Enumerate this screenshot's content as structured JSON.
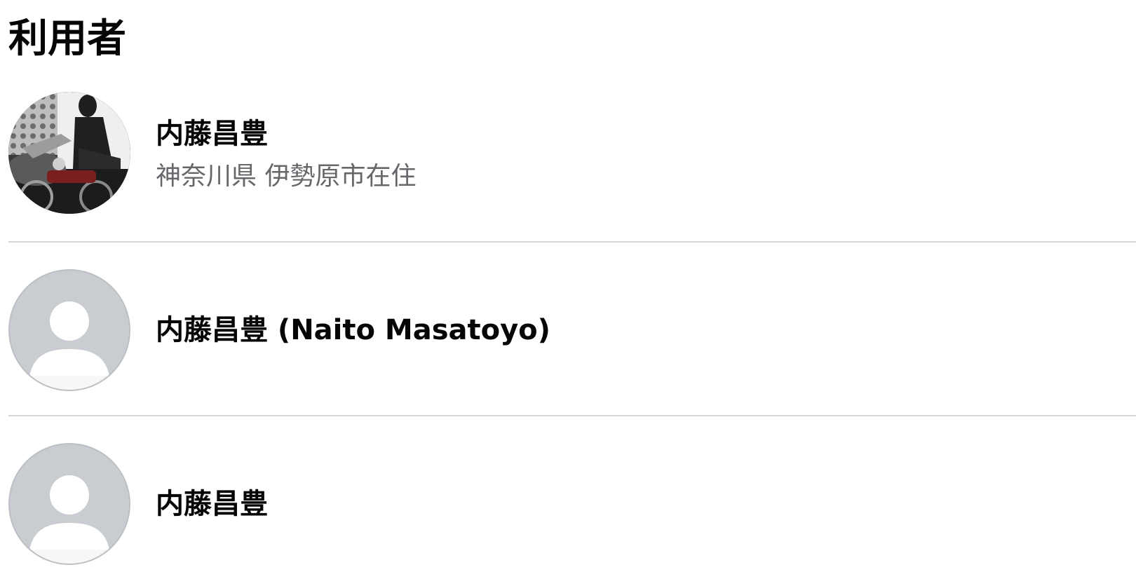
{
  "section": {
    "title": "利用者"
  },
  "users": [
    {
      "name": "内藤昌豊",
      "location": "神奈川県 伊勢原市在住",
      "avatar": "photo-avatar"
    },
    {
      "name": "内藤昌豊 (Naito Masatoyo)",
      "avatar": "default-avatar-icon"
    },
    {
      "name": "内藤昌豊",
      "avatar": "default-avatar-icon"
    }
  ],
  "colors": {
    "title_text": "#050505",
    "secondary_text": "#65676b",
    "divider": "#d6d6d6",
    "avatar_placeholder_bg": "#c9ccd1",
    "avatar_silhouette": "#ffffff"
  }
}
